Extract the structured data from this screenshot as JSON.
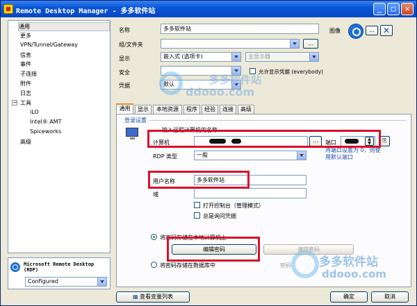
{
  "window": {
    "title": "Remote Desktop Manager - 多多软件站"
  },
  "title_buttons": {
    "minimize": "_",
    "maximize": "□",
    "close": "✕"
  },
  "sidebar": {
    "items": [
      {
        "label": "通用",
        "indent": 0,
        "selected": true
      },
      {
        "label": "更多",
        "indent": 0
      },
      {
        "label": "VPN/Tunnel/Gateway",
        "indent": 0
      },
      {
        "label": "信息",
        "indent": 0
      },
      {
        "label": "事件",
        "indent": 0
      },
      {
        "label": "子连接",
        "indent": 0
      },
      {
        "label": "附件",
        "indent": 0
      },
      {
        "label": "日志",
        "indent": 0
      },
      {
        "label": "工具",
        "indent": 0,
        "expander": "−"
      },
      {
        "label": "iLO",
        "indent": 2
      },
      {
        "label": "Intel® AMT",
        "indent": 2
      },
      {
        "label": "Spiceworks",
        "indent": 2
      },
      {
        "label": "高级",
        "indent": 0
      }
    ]
  },
  "type_panel": {
    "title": "Microsoft Remote Desktop (RDP)",
    "status": "Configured"
  },
  "form": {
    "name_label": "名称",
    "name_value": "多多软件站",
    "image_label": "图像",
    "image_more": "...",
    "group_label": "组/文件夹",
    "group_value": "",
    "group_more": "...",
    "display_label": "显示",
    "display_value": "嵌入式 (选项卡)",
    "display_monitor": "主显示器",
    "security_label": "安全",
    "security_value": "",
    "allow_show_label": "允许显示凭据 (everybody)",
    "credentials_label": "凭据",
    "credentials_value": "默认"
  },
  "tabs": [
    "通用",
    "显示",
    "本地资源",
    "程序",
    "经验",
    "连接",
    "高级"
  ],
  "login": {
    "section_title": "登录设置",
    "hint": "输入远程计算机的名称",
    "computer_label": "计算机",
    "computer_more": "...",
    "port_label": "端口",
    "port_note": "将端口设置为 0，则使用默认端口",
    "rdp_type_label": "RDP 类型",
    "rdp_type_value": "一般",
    "username_label": "用户名称",
    "username_value": "多多软件站",
    "domain_label": "域",
    "domain_value": "",
    "console_label": "打开控制台（管理模式）",
    "always_ask_label": "总是询问凭据",
    "store_local_label": "将密码存储在本地计算机上",
    "edit_password": "编辑密码",
    "clear_password": "清除密码",
    "store_db_label": "将密码存储在数据库中",
    "password_label": "密码"
  },
  "footer": {
    "view_variables": "查看变量列表",
    "ok": "确定",
    "cancel": "取消"
  },
  "watermark": {
    "top_cn": "多多软件站",
    "top_en": "ddooo.com",
    "bottom_cn": "多多软件站",
    "bottom_en": "ddooo.com"
  },
  "colors": {
    "highlight": "#d8102a",
    "title_blue": "#0a57d6",
    "accent_blue": "#1f4ea5"
  }
}
